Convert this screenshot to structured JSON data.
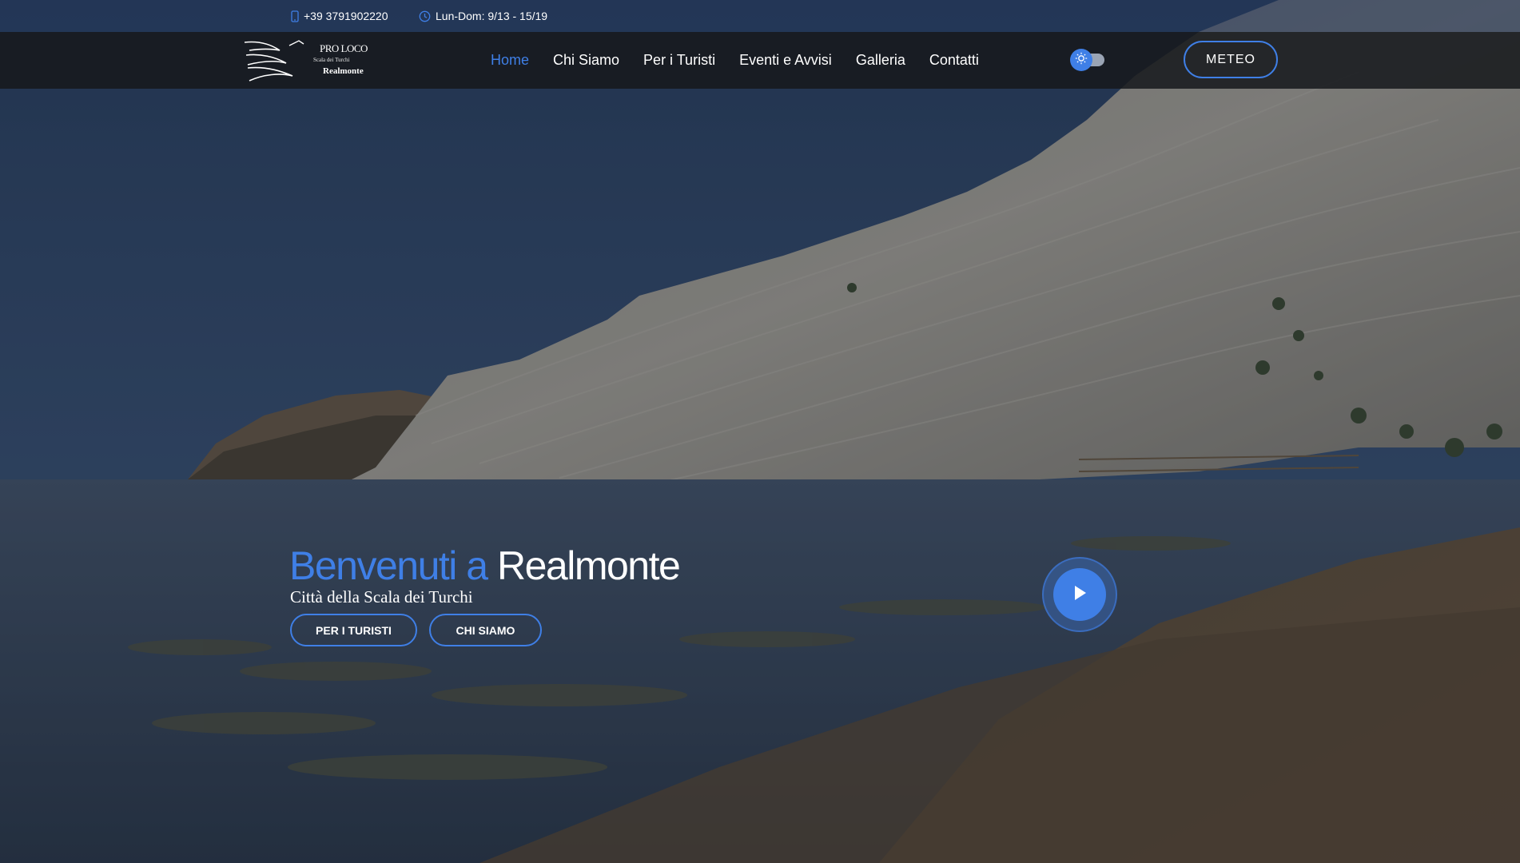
{
  "topbar": {
    "phone": "+39 3791902220",
    "hours": "Lun-Dom: 9/13 - 15/19",
    "phone_icon": "mobile-phone-icon",
    "hours_icon": "clock-icon"
  },
  "logo": {
    "line1": "PRO LOCO",
    "line2": "Scala dei Turchi",
    "line3": "Realmonte"
  },
  "nav": {
    "items": [
      {
        "label": "Home",
        "active": true
      },
      {
        "label": "Chi Siamo",
        "active": false
      },
      {
        "label": "Per i Turisti",
        "active": false
      },
      {
        "label": "Eventi e Avvisi",
        "active": false
      },
      {
        "label": "Galleria",
        "active": false
      },
      {
        "label": "Contatti",
        "active": false
      }
    ],
    "theme_toggle_icon": "sun-icon",
    "meteo_label": "METEO"
  },
  "hero": {
    "title_part1": "Benvenuti a",
    "title_part2": "Realmonte",
    "subtitle": "Città della Scala dei Turchi",
    "btn_turisti": "PER I TURISTI",
    "btn_chisiamo": "CHI SIAMO",
    "play_icon": "play-icon"
  },
  "colors": {
    "accent": "#3f7fe6",
    "navbar_bg": "#16181c",
    "text": "#ffffff"
  }
}
